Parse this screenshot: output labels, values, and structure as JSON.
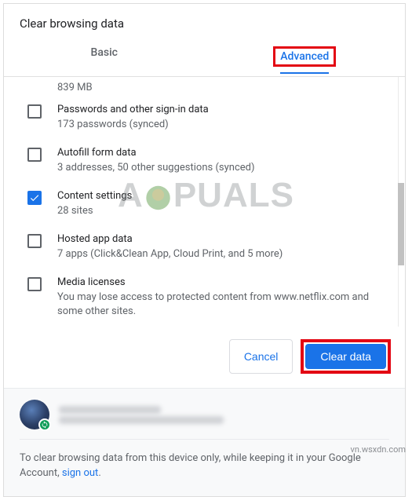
{
  "dialog": {
    "title": "Clear browsing data",
    "tabs": {
      "basic": "Basic",
      "advanced": "Advanced"
    },
    "truncated_line": "839 MB",
    "items": [
      {
        "title": "Passwords and other sign-in data",
        "sub": "173 passwords (synced)",
        "checked": false
      },
      {
        "title": "Autofill form data",
        "sub": "3 addresses, 50 other suggestions (synced)",
        "checked": false
      },
      {
        "title": "Content settings",
        "sub": "28 sites",
        "checked": true
      },
      {
        "title": "Hosted app data",
        "sub": "7 apps (Click&Clean App, Cloud Print, and 5 more)",
        "checked": false
      },
      {
        "title": "Media licenses",
        "sub": "You may lose access to protected content from www.netflix.com and some other sites.",
        "checked": false
      }
    ],
    "actions": {
      "cancel": "Cancel",
      "clear": "Clear data"
    }
  },
  "footer": {
    "text_prefix": "To clear browsing data from this device only, while keeping it in your Google Account, ",
    "link": "sign out",
    "text_suffix": "."
  },
  "watermark": {
    "left": "A",
    "right": "PUALS"
  },
  "source": "vn.wsxdn.com"
}
